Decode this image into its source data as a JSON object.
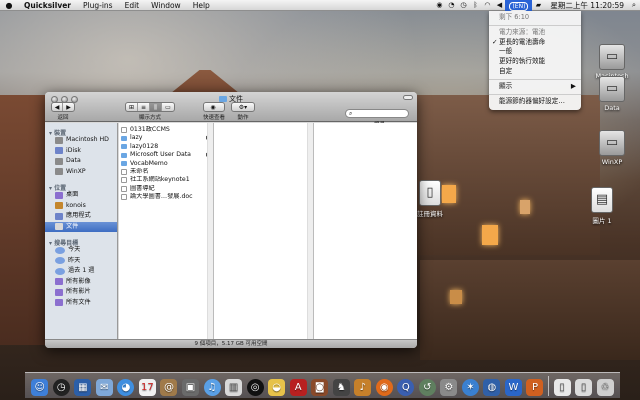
{
  "menubar": {
    "apple": "",
    "app_name": "Quicksilver",
    "menus": [
      "Plug-ins",
      "Edit",
      "Window",
      "Help"
    ],
    "input_source": "(EN)",
    "clock": "星期二上午 11:20:59"
  },
  "battery_menu": {
    "remaining": "剩下 6:10",
    "power_source": "電力來源：電池",
    "options": [
      {
        "label": "更長的電池壽命",
        "checked": true
      },
      {
        "label": "一般",
        "checked": false
      },
      {
        "label": "更好的執行效能",
        "checked": false
      },
      {
        "label": "自定",
        "checked": false
      }
    ],
    "show": "顯示",
    "open_prefs": "能源節約器偏好設定…"
  },
  "desktop_icons": [
    {
      "label": "Macintosh HD",
      "icon": "hard-drive-icon"
    },
    {
      "label": "Data",
      "icon": "hard-drive-icon"
    },
    {
      "label": "WinXP",
      "icon": "hard-drive-icon"
    },
    {
      "label": "圖片 1",
      "icon": "image-file-icon"
    },
    {
      "label": "註冊資料",
      "icon": "document-icon"
    }
  ],
  "finder": {
    "title": "文件",
    "toolbar": {
      "back_label": "返回",
      "view_label": "顯示方式",
      "quicklook_label": "快速查看",
      "action_label": "動作",
      "search_label": "搜尋",
      "search_placeholder": ""
    },
    "sidebar": {
      "devices_head": "裝置",
      "devices": [
        "Macintosh HD",
        "iDisk",
        "Data",
        "WinXP"
      ],
      "places_head": "位置",
      "places": [
        "桌面",
        "konois",
        "應用程式",
        "文件"
      ],
      "search_head": "搜尋目標",
      "searches": [
        "今天",
        "昨天",
        "過去 1 週",
        "所有影像",
        "所有影片",
        "所有文件"
      ]
    },
    "items": [
      {
        "name": "0131政CCMS",
        "folder": false,
        "arrow": false
      },
      {
        "name": "lazy",
        "folder": true,
        "arrow": true
      },
      {
        "name": "lazy0128",
        "folder": true,
        "arrow": false
      },
      {
        "name": "Microsoft User Data",
        "folder": true,
        "arrow": true
      },
      {
        "name": "VocabMemo",
        "folder": true,
        "arrow": false
      },
      {
        "name": "未命名",
        "folder": false,
        "arrow": false
      },
      {
        "name": "社工系網站keynote1",
        "folder": false,
        "arrow": false
      },
      {
        "name": "圖書導紀",
        "folder": false,
        "arrow": false
      },
      {
        "name": "論大學圖書…發展.doc",
        "folder": false,
        "arrow": false
      }
    ],
    "status": "9 個項目，5.17 GB 可用空間"
  },
  "dock_icons": [
    "finder-icon",
    "dashboard-icon",
    "spaces-icon",
    "mail-icon",
    "ichat-icon",
    "ical-icon",
    "address-book-icon",
    "photos-icon",
    "itunes-icon",
    "preview-icon",
    "dvd-icon",
    "adium-icon",
    "pdf-icon",
    "photo-booth-icon",
    "chess-icon",
    "guitar-icon",
    "firefox-icon",
    "quicktime-icon",
    "time-machine-icon",
    "system-prefs-icon",
    "safari-icon",
    "network-icon",
    "word-icon",
    "powerpoint-icon",
    "documents-stack-icon",
    "downloads-stack-icon",
    "trash-icon"
  ]
}
